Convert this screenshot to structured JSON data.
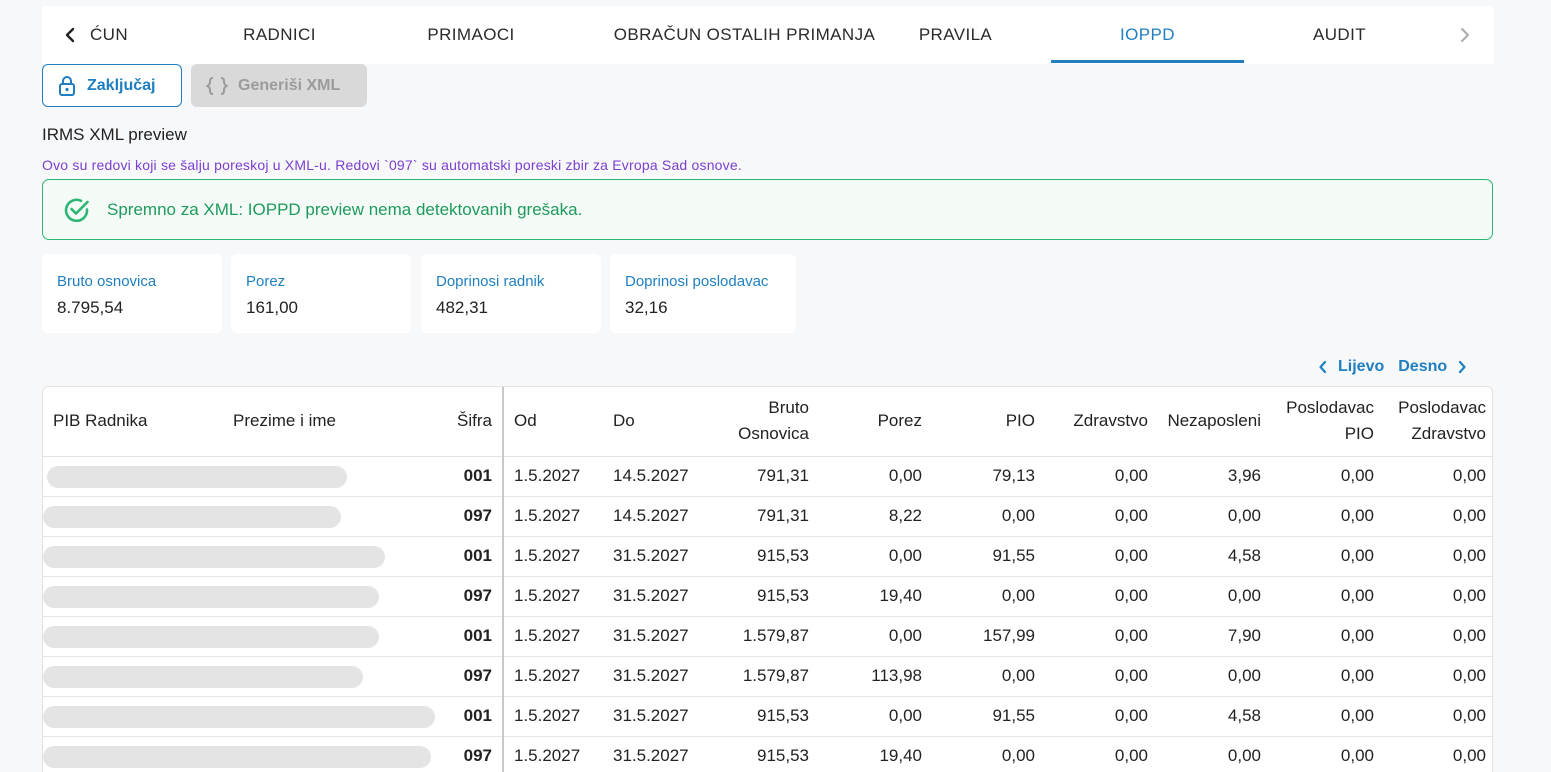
{
  "tabs": {
    "items": [
      {
        "label": "ĆUN"
      },
      {
        "label": "RADNICI"
      },
      {
        "label": "PRIMAOCI"
      },
      {
        "label": "OBRAČUN OSTALIH PRIMANJA"
      },
      {
        "label": "PRAVILA"
      },
      {
        "label": "IOPPD",
        "active": true
      },
      {
        "label": "AUDIT"
      }
    ]
  },
  "actions": {
    "lock_label": "Zaključaj",
    "generate_xml_label": "Generiši XML",
    "generate_xml_disabled": true
  },
  "section": {
    "title": "IRMS XML preview",
    "description": "Ovo su redovi koji se šalju poreskoj u XML-u. Redovi `097` su automatski poreski zbir za Evropa Sad osnove."
  },
  "alert": {
    "text": "Spremno za XML: IOPPD preview nema detektovanih grešaka."
  },
  "summary": [
    {
      "label": "Bruto osnovica",
      "value": "8.795,54"
    },
    {
      "label": "Porez",
      "value": "161,00"
    },
    {
      "label": "Doprinosi radnik",
      "value": "482,31"
    },
    {
      "label": "Doprinosi poslodavac",
      "value": "32,16"
    }
  ],
  "pager": {
    "prev_label": "Lijevo",
    "next_label": "Desno"
  },
  "table": {
    "headers": {
      "pib": "PIB Radnika",
      "name": "Prezime i ime",
      "code": "Šifra",
      "from": "Od",
      "to": "Do",
      "gross_line1": "Bruto",
      "gross_line2": "Osnovica",
      "tax": "Porez",
      "pio": "PIO",
      "health": "Zdravstvo",
      "unemployed": "Nezaposleni",
      "emp_pio_line1": "Poslodavac",
      "emp_pio_line2": "PIO",
      "emp_health_line1": "Poslodavac",
      "emp_health_line2": "Zdravstvo"
    },
    "rows": [
      {
        "code": "001",
        "from": "1.5.2027",
        "to": "14.5.2027",
        "gross": "791,31",
        "tax": "0,00",
        "pio": "79,13",
        "health": "0,00",
        "unemployed": "3,96",
        "emp_pio": "0,00",
        "emp_health": "0,00"
      },
      {
        "code": "097",
        "from": "1.5.2027",
        "to": "14.5.2027",
        "gross": "791,31",
        "tax": "8,22",
        "pio": "0,00",
        "health": "0,00",
        "unemployed": "0,00",
        "emp_pio": "0,00",
        "emp_health": "0,00"
      },
      {
        "code": "001",
        "from": "1.5.2027",
        "to": "31.5.2027",
        "gross": "915,53",
        "tax": "0,00",
        "pio": "91,55",
        "health": "0,00",
        "unemployed": "4,58",
        "emp_pio": "0,00",
        "emp_health": "0,00"
      },
      {
        "code": "097",
        "from": "1.5.2027",
        "to": "31.5.2027",
        "gross": "915,53",
        "tax": "19,40",
        "pio": "0,00",
        "health": "0,00",
        "unemployed": "0,00",
        "emp_pio": "0,00",
        "emp_health": "0,00"
      },
      {
        "code": "001",
        "from": "1.5.2027",
        "to": "31.5.2027",
        "gross": "1.579,87",
        "tax": "0,00",
        "pio": "157,99",
        "health": "0,00",
        "unemployed": "7,90",
        "emp_pio": "0,00",
        "emp_health": "0,00"
      },
      {
        "code": "097",
        "from": "1.5.2027",
        "to": "31.5.2027",
        "gross": "1.579,87",
        "tax": "113,98",
        "pio": "0,00",
        "health": "0,00",
        "unemployed": "0,00",
        "emp_pio": "0,00",
        "emp_health": "0,00"
      },
      {
        "code": "001",
        "from": "1.5.2027",
        "to": "31.5.2027",
        "gross": "915,53",
        "tax": "0,00",
        "pio": "91,55",
        "health": "0,00",
        "unemployed": "4,58",
        "emp_pio": "0,00",
        "emp_health": "0,00"
      },
      {
        "code": "097",
        "from": "1.5.2027",
        "to": "31.5.2027",
        "gross": "915,53",
        "tax": "19,40",
        "pio": "0,00",
        "health": "0,00",
        "unemployed": "0,00",
        "emp_pio": "0,00",
        "emp_health": "0,00"
      }
    ]
  },
  "colors": {
    "accent": "#1f7fc1",
    "success": "#2bb673",
    "description": "#7b3fd1",
    "disabled": "#d9d9d9"
  },
  "icons": {
    "tab_prev": "chevron-left-icon",
    "tab_next": "chevron-right-icon",
    "lock": "lock-icon",
    "xml": "code-braces-icon",
    "success": "check-circle-icon"
  }
}
